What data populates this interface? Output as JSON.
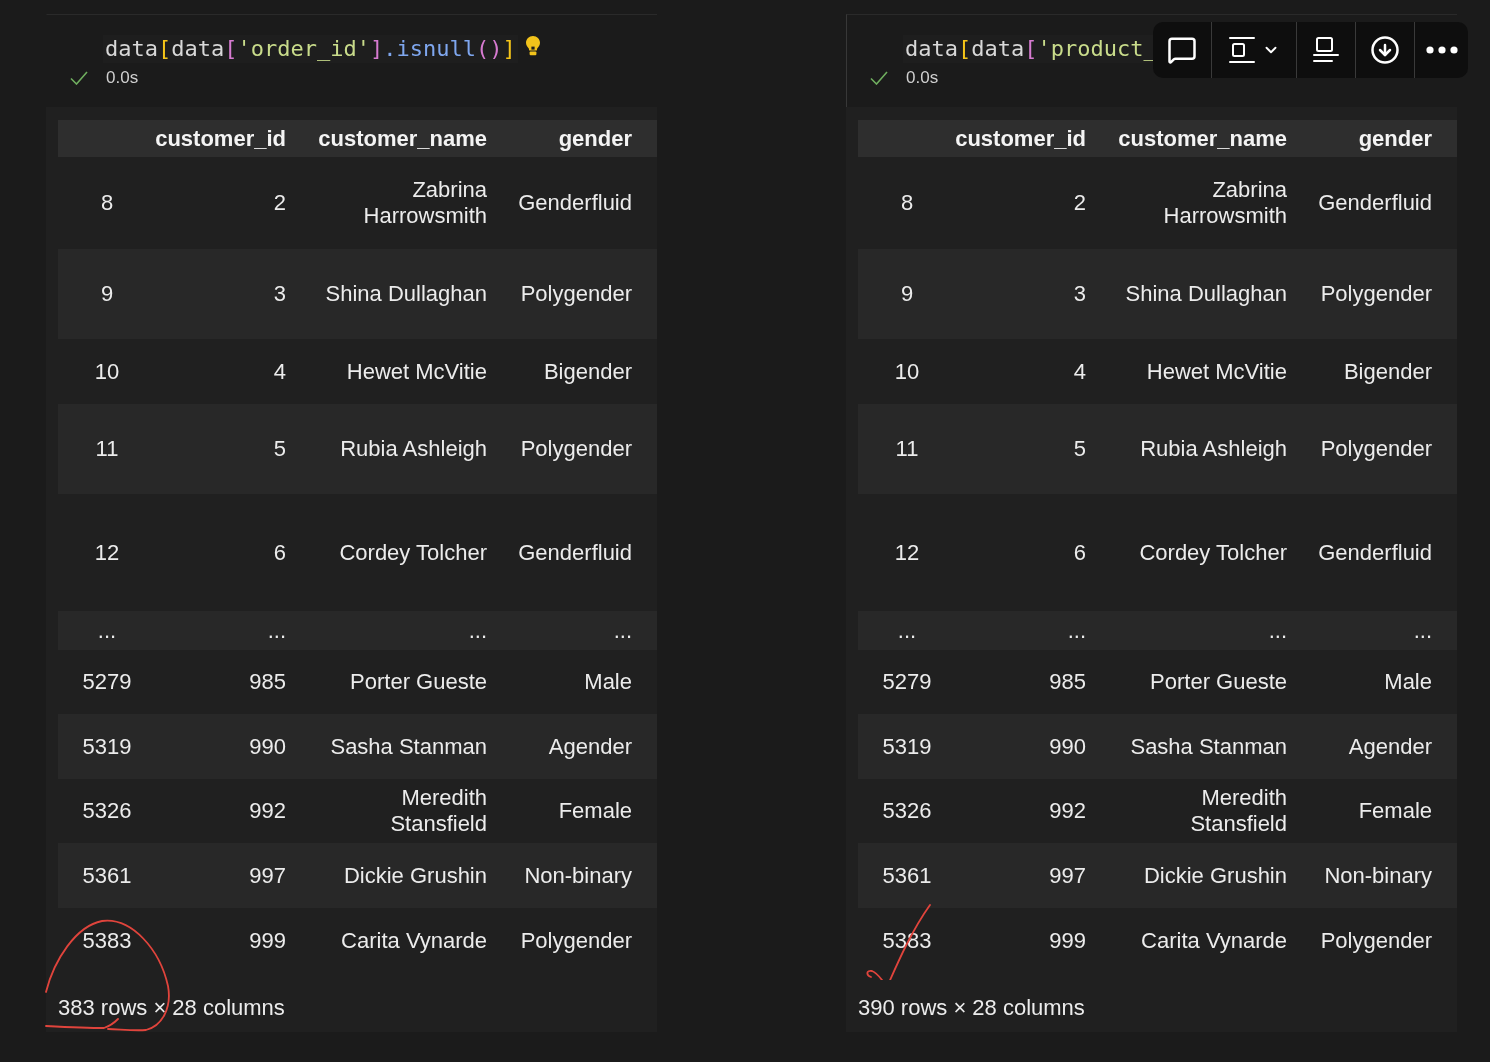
{
  "cells": [
    {
      "code": [
        {
          "text": "data",
          "kind": "name"
        },
        {
          "text": "[",
          "kind": "bracket-outer"
        },
        {
          "text": "data",
          "kind": "name"
        },
        {
          "text": "[",
          "kind": "bracket-inner"
        },
        {
          "text": "'order_id'",
          "kind": "string"
        },
        {
          "text": "]",
          "kind": "bracket-inner"
        },
        {
          "text": ".isnull",
          "kind": "method"
        },
        {
          "text": "()",
          "kind": "bracket-inner"
        },
        {
          "text": "]",
          "kind": "bracket-outer"
        }
      ],
      "lightbulb": true,
      "focused": false,
      "status": {
        "time": "0.0s"
      },
      "table": {
        "columns": [
          "customer_id",
          "customer_name",
          "gender"
        ],
        "rows": [
          {
            "index": "8",
            "cells": [
              "2",
              "Zabrina Harrowsmith",
              "Genderfluid"
            ]
          },
          {
            "index": "9",
            "cells": [
              "3",
              "Shina Dullaghan",
              "Polygender"
            ]
          },
          {
            "index": "10",
            "cells": [
              "4",
              "Hewet McVitie",
              "Bigender"
            ]
          },
          {
            "index": "11",
            "cells": [
              "5",
              "Rubia Ashleigh",
              "Polygender"
            ]
          },
          {
            "index": "12",
            "cells": [
              "6",
              "Cordey Tolcher",
              "Genderfluid"
            ]
          },
          {
            "index": "...",
            "cells": [
              "...",
              "...",
              "..."
            ]
          },
          {
            "index": "5279",
            "cells": [
              "985",
              "Porter Gueste",
              "Male"
            ]
          },
          {
            "index": "5319",
            "cells": [
              "990",
              "Sasha Stanman",
              "Agender"
            ]
          },
          {
            "index": "5326",
            "cells": [
              "992",
              "Meredith Stansfield",
              "Female"
            ]
          },
          {
            "index": "5361",
            "cells": [
              "997",
              "Dickie Grushin",
              "Non-binary"
            ]
          },
          {
            "index": "5383",
            "cells": [
              "999",
              "Carita Vynarde",
              "Polygender"
            ]
          }
        ]
      },
      "summary": "383 rows × 28 columns",
      "annotation": {
        "kind": "circle"
      }
    },
    {
      "code": [
        {
          "text": "data",
          "kind": "name"
        },
        {
          "text": "[",
          "kind": "bracket-outer"
        },
        {
          "text": "data",
          "kind": "name"
        },
        {
          "text": "[",
          "kind": "bracket-inner"
        },
        {
          "text": "'product_",
          "kind": "string"
        }
      ],
      "lightbulb": false,
      "focused": true,
      "status": {
        "time": "0.0s"
      },
      "table": {
        "columns": [
          "customer_id",
          "customer_name",
          "gender"
        ],
        "rows": [
          {
            "index": "8",
            "cells": [
              "2",
              "Zabrina Harrowsmith",
              "Genderfluid"
            ]
          },
          {
            "index": "9",
            "cells": [
              "3",
              "Shina Dullaghan",
              "Polygender"
            ]
          },
          {
            "index": "10",
            "cells": [
              "4",
              "Hewet McVitie",
              "Bigender"
            ]
          },
          {
            "index": "11",
            "cells": [
              "5",
              "Rubia Ashleigh",
              "Polygender"
            ]
          },
          {
            "index": "12",
            "cells": [
              "6",
              "Cordey Tolcher",
              "Genderfluid"
            ]
          },
          {
            "index": "...",
            "cells": [
              "...",
              "...",
              "..."
            ]
          },
          {
            "index": "5279",
            "cells": [
              "985",
              "Porter Gueste",
              "Male"
            ]
          },
          {
            "index": "5319",
            "cells": [
              "990",
              "Sasha Stanman",
              "Agender"
            ]
          },
          {
            "index": "5326",
            "cells": [
              "992",
              "Meredith Stansfield",
              "Female"
            ]
          },
          {
            "index": "5361",
            "cells": [
              "997",
              "Dickie Grushin",
              "Non-binary"
            ]
          },
          {
            "index": "5383",
            "cells": [
              "999",
              "Carita Vynarde",
              "Polygender"
            ]
          }
        ]
      },
      "summary": "390 rows × 28 columns",
      "annotation": {
        "kind": "check"
      }
    }
  ]
}
